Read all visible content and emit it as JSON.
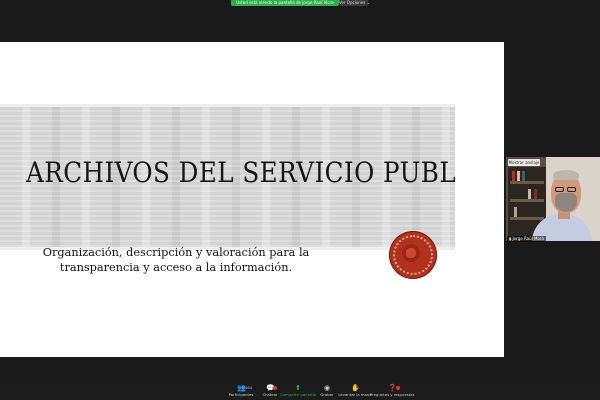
{
  "meeting": {
    "share_banner": "Usted está viendo la pantalla de Jorge Raúl Mora",
    "options_label": "Ver Opciones ⌄"
  },
  "slide": {
    "title": "ARCHIVOS DEL SERVICIO PUBLICO",
    "subtitle": "Organización, descripción y valoración para la transparencia y acceso a la información."
  },
  "video": {
    "stop_share_label": "Mostrar anclaje",
    "participant_name": "Jorge Raúl Mora"
  },
  "toolbar": {
    "participants_label": "Participantes",
    "participants_count": "464",
    "chat_label": "Chatear",
    "share_label": "Compartir pantalla",
    "record_label": "Grabar",
    "raise_hand_label": "Levantar la mano",
    "qa_label": "Preguntas y respuestas"
  },
  "colors": {
    "share_green": "#2fae4c",
    "seal_red": "#b0311d",
    "alert_red": "#e0342b"
  }
}
